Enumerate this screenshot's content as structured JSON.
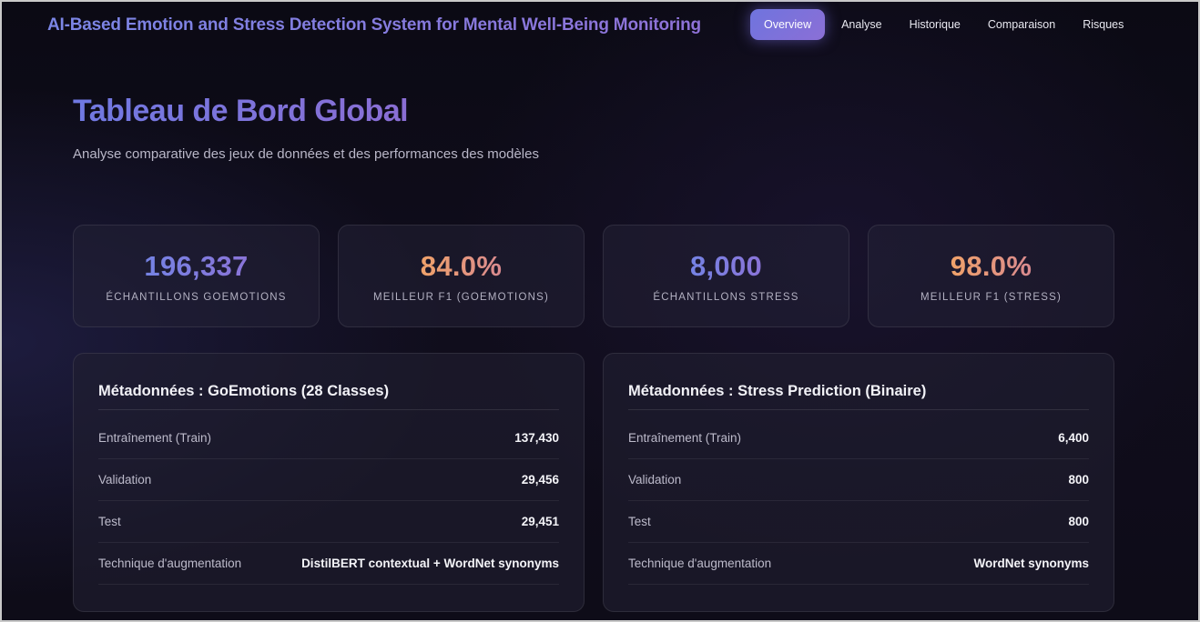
{
  "header": {
    "brand": "AI-Based Emotion and Stress Detection System for Mental Well-Being Monitoring",
    "nav": [
      {
        "label": "Overview",
        "active": true
      },
      {
        "label": "Analyse",
        "active": false
      },
      {
        "label": "Historique",
        "active": false
      },
      {
        "label": "Comparaison",
        "active": false
      },
      {
        "label": "Risques",
        "active": false
      }
    ]
  },
  "main": {
    "title": "Tableau de Bord Global",
    "subtitle": "Analyse comparative des jeux de données et des performances des modèles",
    "stats": [
      {
        "value": "196,337",
        "label": "Échantillons GoEmotions",
        "color": "#7b80e0"
      },
      {
        "value": "84.0%",
        "label": "Meilleur F1 (GoEmotions)",
        "color": "#e89a7a"
      },
      {
        "value": "8,000",
        "label": "Échantillons Stress",
        "color": "#7b80e0"
      },
      {
        "value": "98.0%",
        "label": "Meilleur F1 (Stress)",
        "color": "#e89a7a"
      }
    ],
    "panels": [
      {
        "title": "Métadonnées : GoEmotions (28 Classes)",
        "rows": [
          {
            "key": "Entraînement (Train)",
            "value": "137,430"
          },
          {
            "key": "Validation",
            "value": "29,456"
          },
          {
            "key": "Test",
            "value": "29,451"
          },
          {
            "key": "Technique d'augmentation",
            "value": "DistilBERT contextual + WordNet synonyms"
          }
        ]
      },
      {
        "title": "Métadonnées : Stress Prediction (Binaire)",
        "rows": [
          {
            "key": "Entraînement (Train)",
            "value": "6,400"
          },
          {
            "key": "Validation",
            "value": "800"
          },
          {
            "key": "Test",
            "value": "800"
          },
          {
            "key": "Technique d'augmentation",
            "value": "WordNet synonyms"
          }
        ]
      }
    ]
  }
}
